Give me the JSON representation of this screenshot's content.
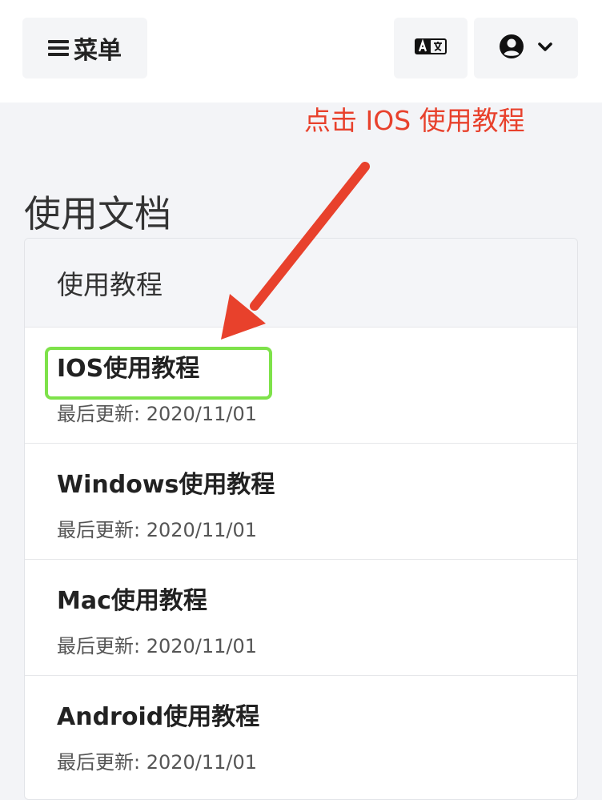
{
  "header": {
    "menu_label": "菜单",
    "menu_icon": "hamburger-icon",
    "language_icon": "translate-icon",
    "user_icon": "user-circle-icon",
    "dropdown_icon": "chevron-down-icon"
  },
  "annotation": {
    "text": "点击 IOS 使用教程",
    "text_color": "#e8412c",
    "highlight_color": "#7ee24a"
  },
  "page": {
    "title": "使用文档"
  },
  "docs_card": {
    "header": "使用教程",
    "items": [
      {
        "title": "IOS使用教程",
        "meta": "最后更新: 2020/11/01"
      },
      {
        "title": "Windows使用教程",
        "meta": "最后更新: 2020/11/01"
      },
      {
        "title": "Mac使用教程",
        "meta": "最后更新: 2020/11/01"
      },
      {
        "title": "Android使用教程",
        "meta": "最后更新: 2020/11/01"
      }
    ]
  }
}
